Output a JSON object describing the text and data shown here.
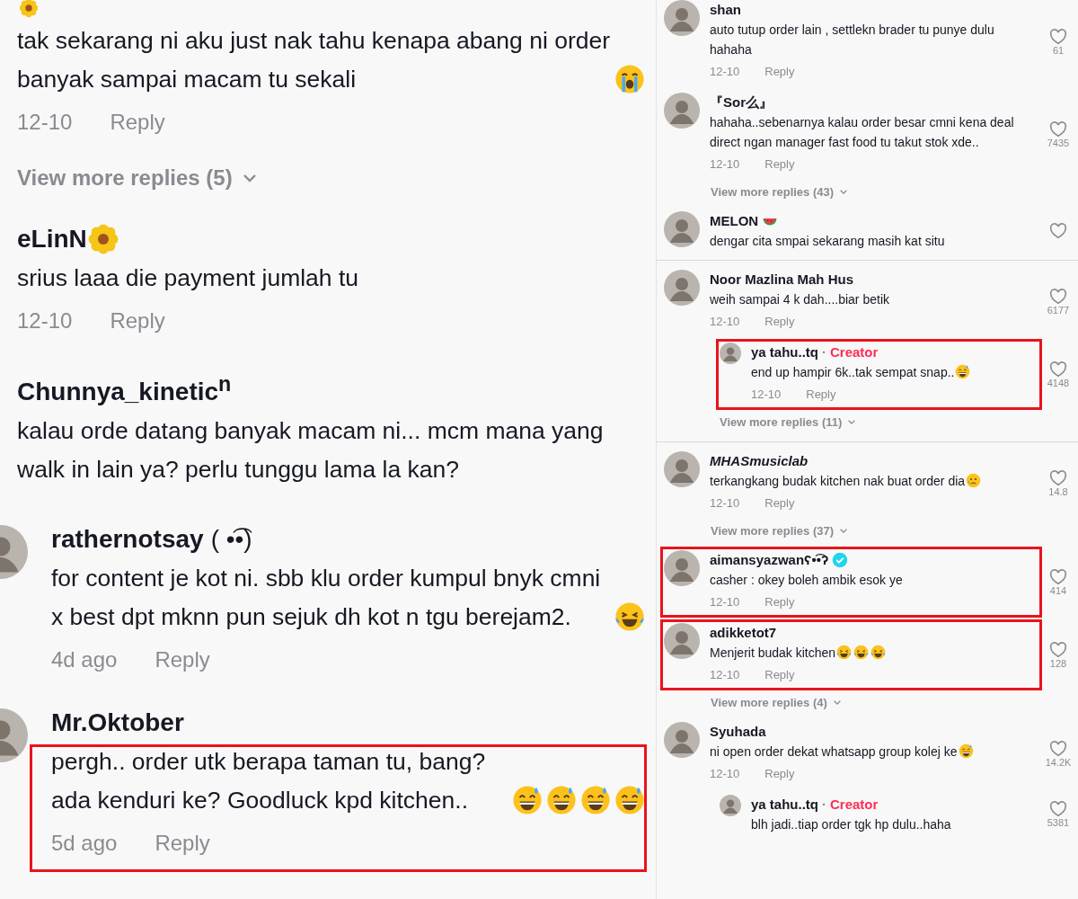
{
  "columns": [
    {
      "kind": "large",
      "panels": [
        {
          "comments": [
            {
              "avatar": false,
              "name_icon": {
                "kind": "flower"
              },
              "text": "tak sekarang ni aku just nak tahu kenapa abang ni order banyak sampai macam tu sekali",
              "emojis": [
                {
                  "kind": "crying"
                }
              ],
              "date": "12-10",
              "reply": "Reply",
              "highlighted": false,
              "view_more": "View more replies (5)"
            },
            {
              "avatar": false,
              "name": "eLinN",
              "name_icon": {
                "kind": "flower"
              },
              "text": "srius laaa die payment jumlah tu",
              "date": "12-10",
              "reply": "Reply",
              "highlighted": false
            },
            {
              "avatar": false,
              "name": "Chunnya_kinetic$^{n}$",
              "text": "kalau orde datang banyak macam ni... mcm mana yang walk in lain ya? perlu tunggu lama la kan?",
              "highlighted": false
            }
          ]
        },
        {
          "comments": [
            {
              "avatar": true,
              "name": "rathernotsay",
              "name_extra": "( •͡•)",
              "text": "for content je kot ni. sbb klu order kumpul bnyk cmni x best dpt mknn pun sejuk dh kot n tgu berejam2.",
              "emojis": [
                {
                  "kind": "laughing"
                }
              ],
              "date": "4d ago",
              "reply": "Reply",
              "highlighted": false
            },
            {
              "avatar": true,
              "name": "Mr.Oktober",
              "text": "pergh.. order utk berapa taman tu, bang? ada kenduri ke? Goodluck kpd kitchen..",
              "emojis": [
                {
                  "kind": "sweat"
                },
                {
                  "kind": "sweat"
                },
                {
                  "kind": "sweat"
                },
                {
                  "kind": "sweat"
                }
              ],
              "date": "5d ago",
              "reply": "Reply",
              "highlighted": true
            }
          ]
        }
      ]
    },
    {
      "kind": "small",
      "panels": [
        {
          "comments": [
            {
              "avatar": true,
              "name": "shan",
              "text": "auto tutup order lain , settlekn brader tu punye dulu hahaha",
              "date": "12-10",
              "reply": "Reply",
              "likes": "61",
              "highlighted": false
            },
            {
              "avatar": true,
              "name": "『Sor么』",
              "text": "hahaha..sebenarnya kalau order besar cmni kena deal direct ngan manager fast food tu takut stok xde..",
              "date": "12-10",
              "reply": "Reply",
              "likes": "7435",
              "highlighted": false,
              "view_more": "View more replies (43)"
            },
            {
              "avatar": true,
              "name": "MELON",
              "name_icon": {
                "kind": "watermelon"
              },
              "text": "dengar cita smpai sekarang masih kat situ",
              "highlighted": false
            }
          ]
        },
        {
          "comments": [
            {
              "avatar": true,
              "name": "Noor Mazlina Mah Hus",
              "text": "weih sampai 4 k dah....biar betik",
              "date": "12-10",
              "reply": "Reply",
              "likes": "6177",
              "highlighted": false,
              "view_more": "View more replies (11)",
              "replies": [
                {
                  "avatar": true,
                  "name": "ya tahu..tq",
                  "badge": {
                    "dot": "·",
                    "label": "Creator"
                  },
                  "text": "end up hampir 6k..tak sempat snap..",
                  "emojis": [
                    {
                      "kind": "sweat"
                    }
                  ],
                  "date": "12-10",
                  "reply": "Reply",
                  "likes": "4148",
                  "highlighted": true
                }
              ]
            }
          ]
        },
        {
          "comments": [
            {
              "avatar": true,
              "name": "MHASmusiclab",
              "italic": true,
              "text": "terkangkang budak kitchen nak buat order dia",
              "emojis": [
                {
                  "kind": "sad"
                }
              ],
              "date": "12-10",
              "reply": "Reply",
              "likes": "14.8",
              "highlighted": false,
              "view_more": "View more replies (37)"
            },
            {
              "avatar": true,
              "name": "aimansyazwan",
              "name_extra": "ʕ•͡•ʔ",
              "verified": true,
              "text": "casher : okey boleh ambik esok ye",
              "date": "12-10",
              "reply": "Reply",
              "likes": "414",
              "highlighted": true
            },
            {
              "avatar": true,
              "name": "adikketot7",
              "text": "Menjerit budak kitchen",
              "emojis": [
                {
                  "kind": "laughing"
                },
                {
                  "kind": "laughing"
                },
                {
                  "kind": "laughing"
                }
              ],
              "date": "12-10",
              "reply": "Reply",
              "likes": "128",
              "highlighted": true,
              "view_more": "View more replies (4)"
            },
            {
              "avatar": true,
              "name": "Syuhada",
              "text": "ni open order dekat whatsapp group kolej ke",
              "emojis": [
                {
                  "kind": "sweat"
                }
              ],
              "date": "12-10",
              "reply": "Reply",
              "likes": "14.2K",
              "highlighted": false,
              "replies": [
                {
                  "avatar": true,
                  "name": "ya tahu..tq",
                  "badge": {
                    "dot": "·",
                    "label": "Creator"
                  },
                  "text": "blh jadi..tiap order tgk hp dulu..haha",
                  "likes": "5381",
                  "highlighted": false
                }
              ]
            }
          ]
        }
      ]
    }
  ]
}
